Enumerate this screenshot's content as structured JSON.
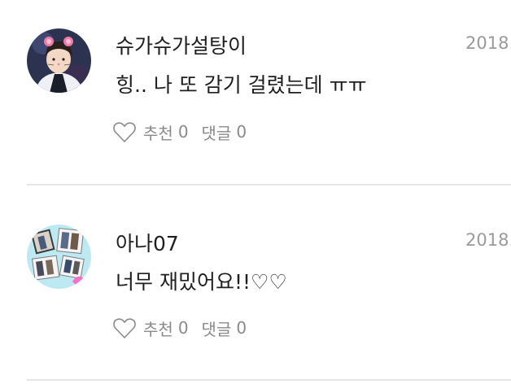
{
  "comments": [
    {
      "author": "슈가슈가설탕이",
      "date": "2018.",
      "text": "힝.. 나 또  감기 걸렸는데 ㅠㅠ",
      "like_label": "추천",
      "like_count": "0",
      "reply_label": "댓글",
      "reply_count": "0"
    },
    {
      "author": "아나07",
      "date": "2018.",
      "text": "너무 재밌어요!!♡♡",
      "like_label": "추천",
      "like_count": "0",
      "reply_label": "댓글",
      "reply_count": "0"
    }
  ],
  "colors": {
    "text": "#1f1f1f",
    "muted": "#8a8a8a",
    "date": "#9a9a9a",
    "divider": "#e6e6e6"
  },
  "icons": {
    "like": "heart-outline-icon"
  }
}
